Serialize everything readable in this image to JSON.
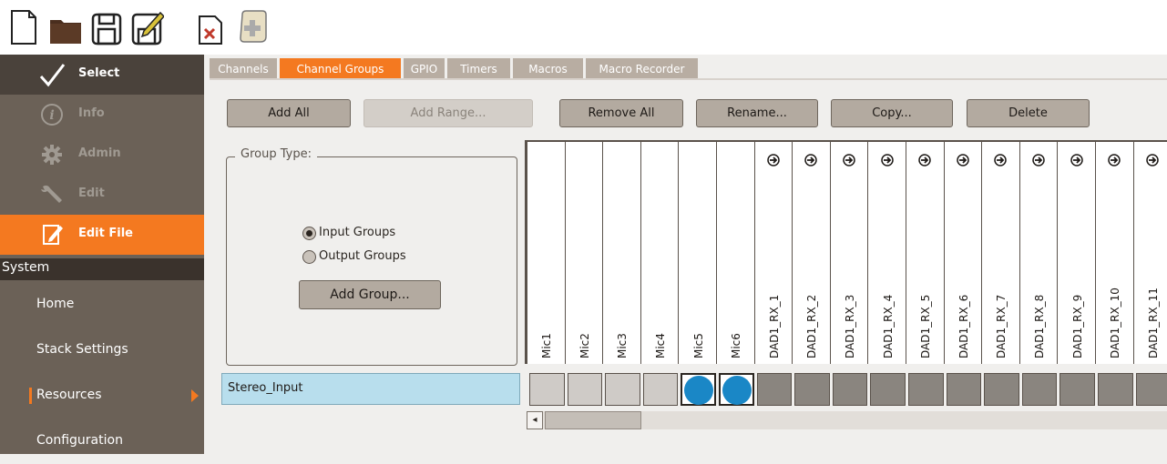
{
  "toolbar": {
    "buttons": [
      {
        "name": "new-file-icon"
      },
      {
        "name": "open-folder-icon"
      },
      {
        "name": "save-icon"
      },
      {
        "name": "save-as-icon"
      },
      {
        "name": "close-file-icon"
      },
      {
        "name": "script-icon"
      }
    ]
  },
  "sidebar": {
    "items": [
      {
        "label": "Select",
        "icon": "checkmark-icon"
      },
      {
        "label": "Info",
        "icon": "info-icon"
      },
      {
        "label": "Admin",
        "icon": "gear-icon"
      },
      {
        "label": "Edit",
        "icon": "wrench-icon"
      },
      {
        "label": "Edit File",
        "icon": "edit-file-icon"
      }
    ],
    "section_header": "System",
    "sub_items": [
      {
        "label": "Home"
      },
      {
        "label": "Stack Settings"
      },
      {
        "label": "Resources"
      },
      {
        "label": "Configuration"
      }
    ]
  },
  "tabs": [
    {
      "label": "Channels"
    },
    {
      "label": "Channel Groups"
    },
    {
      "label": "GPIO"
    },
    {
      "label": "Timers"
    },
    {
      "label": "Macros"
    },
    {
      "label": "Macro Recorder"
    }
  ],
  "actions": {
    "add_all": "Add All",
    "add_range": "Add Range...",
    "remove_all": "Remove All",
    "rename": "Rename...",
    "copy": "Copy...",
    "delete": "Delete"
  },
  "group_type": {
    "legend": "Group Type:",
    "input_groups": "Input Groups",
    "output_groups": "Output Groups",
    "selected": "Input Groups",
    "add_group": "Add Group..."
  },
  "group_row": {
    "name": "Stereo_Input"
  },
  "channels": [
    {
      "label": "Mic1",
      "icon": "",
      "state": "light"
    },
    {
      "label": "Mic2",
      "icon": "",
      "state": "light"
    },
    {
      "label": "Mic3",
      "icon": "",
      "state": "light"
    },
    {
      "label": "Mic4",
      "icon": "",
      "state": "light"
    },
    {
      "label": "Mic5",
      "icon": "",
      "state": "selected"
    },
    {
      "label": "Mic6",
      "icon": "",
      "state": "selected"
    },
    {
      "label": "DAD1_RX_1",
      "icon": "network-input-icon",
      "state": "dark"
    },
    {
      "label": "DAD1_RX_2",
      "icon": "network-input-icon",
      "state": "dark"
    },
    {
      "label": "DAD1_RX_3",
      "icon": "network-input-icon",
      "state": "dark"
    },
    {
      "label": "DAD1_RX_4",
      "icon": "network-input-icon",
      "state": "dark"
    },
    {
      "label": "DAD1_RX_5",
      "icon": "network-input-icon",
      "state": "dark"
    },
    {
      "label": "DAD1_RX_6",
      "icon": "network-input-icon",
      "state": "dark"
    },
    {
      "label": "DAD1_RX_7",
      "icon": "network-input-icon",
      "state": "dark"
    },
    {
      "label": "DAD1_RX_8",
      "icon": "network-input-icon",
      "state": "dark"
    },
    {
      "label": "DAD1_RX_9",
      "icon": "network-input-icon",
      "state": "dark"
    },
    {
      "label": "DAD1_RX_10",
      "icon": "network-input-icon",
      "state": "dark"
    },
    {
      "label": "DAD1_RX_11",
      "icon": "network-input-icon",
      "state": "dark"
    }
  ],
  "scrollbar": {
    "left_arrow": "◂"
  },
  "colors": {
    "accent": "#f47920",
    "sidebar": "#6b6157",
    "selection_dot": "#1a87c6",
    "group_row_bg": "#b8deed"
  }
}
